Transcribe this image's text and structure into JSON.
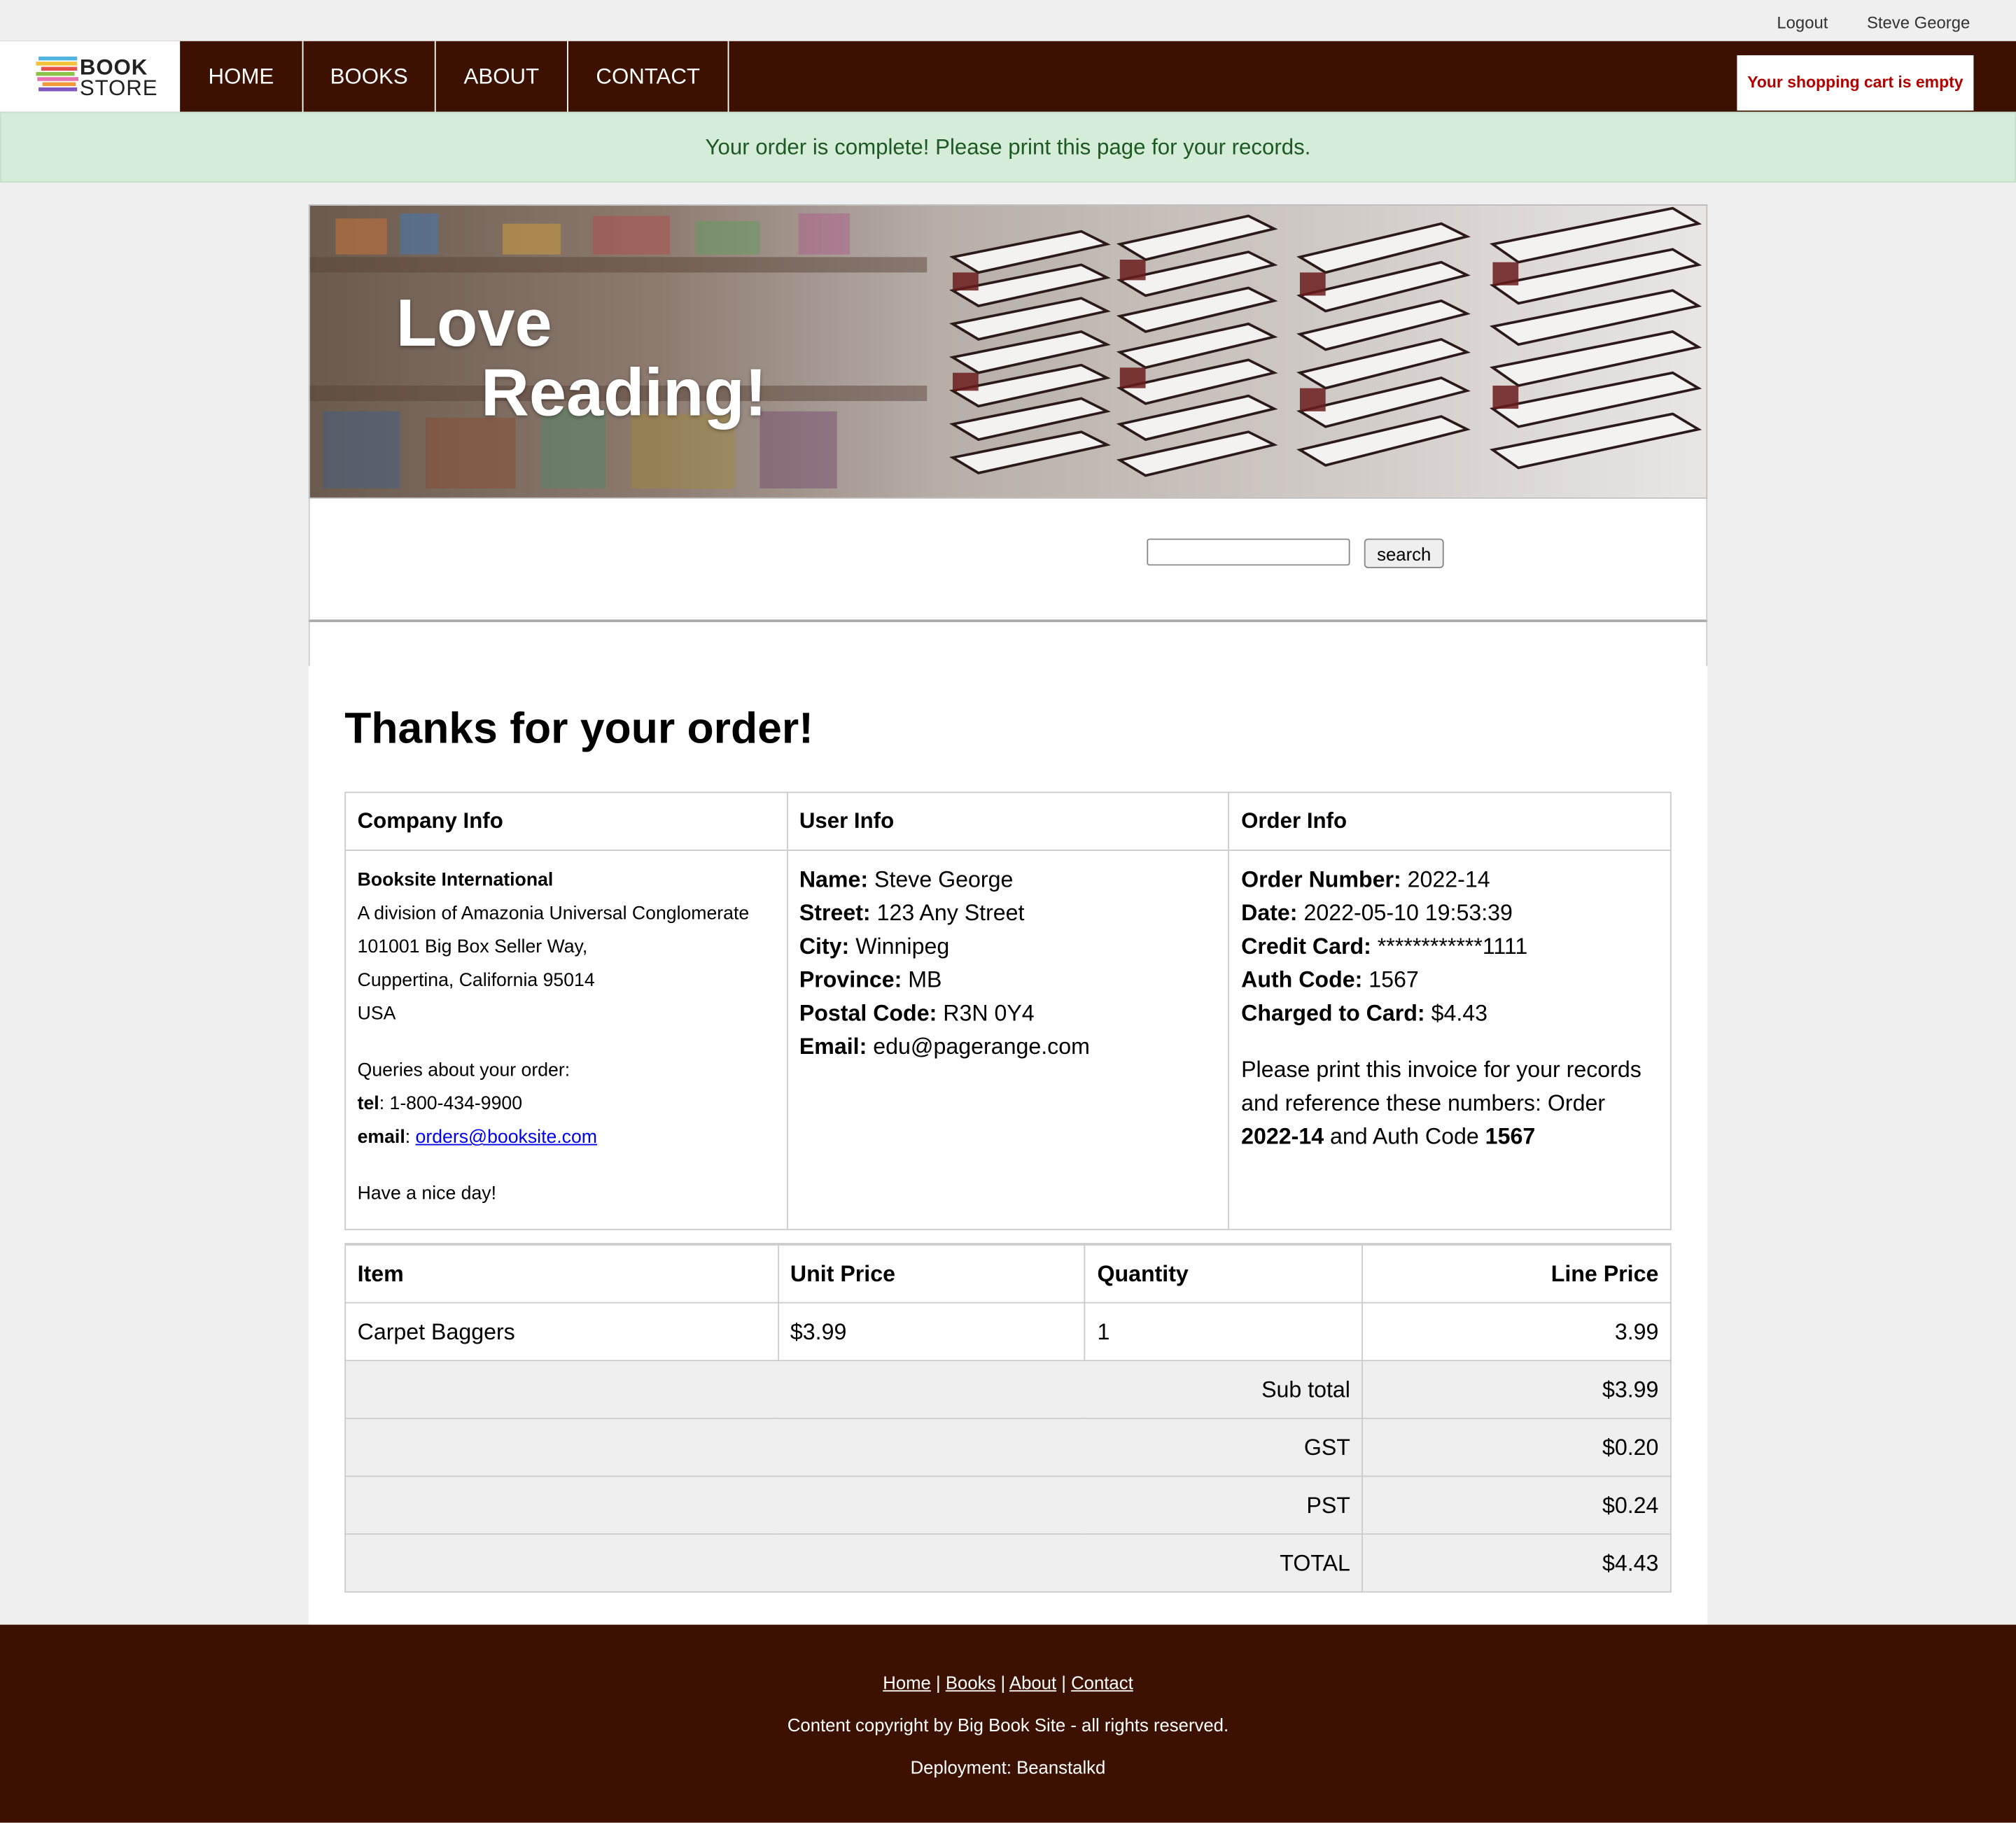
{
  "topbar": {
    "logout": "Logout",
    "user": "Steve George"
  },
  "logo": {
    "line1": "BOOK",
    "line2": "STORE"
  },
  "nav": {
    "items": [
      "HOME",
      "BOOKS",
      "ABOUT",
      "CONTACT"
    ]
  },
  "cart": {
    "status": "Your shopping cart is empty"
  },
  "alert": {
    "message": "Your order is complete! Please print this page for your records."
  },
  "banner": {
    "line1": "Love",
    "line2": "Reading!"
  },
  "search": {
    "value": "",
    "button": "search"
  },
  "page": {
    "title": "Thanks for your order!"
  },
  "info": {
    "headers": [
      "Company Info",
      "User Info",
      "Order Info"
    ],
    "company": {
      "name": "Booksite International",
      "lines": [
        "A division of Amazonia Universal Conglomerate",
        "101001 Big Box Seller Way,",
        "Cuppertina, California 95014",
        "USA"
      ],
      "queries": "Queries about your order:",
      "tel_label": "tel",
      "tel": "1-800-434-9900",
      "email_label": "email",
      "email": "orders@booksite.com",
      "closing": "Have a nice day!"
    },
    "user": {
      "name_label": "Name:",
      "name": "Steve George",
      "street_label": "Street:",
      "street": "123 Any Street",
      "city_label": "City:",
      "city": "Winnipeg",
      "province_label": "Province:",
      "province": "MB",
      "postal_label": "Postal Code:",
      "postal": "R3N 0Y4",
      "email_label": "Email:",
      "email": "edu@pagerange.com"
    },
    "order": {
      "number_label": "Order Number:",
      "number": "2022-14",
      "date_label": "Date:",
      "date": "2022-05-10 19:53:39",
      "card_label": "Credit Card:",
      "card": "************1111",
      "auth_label": "Auth Code:",
      "auth": "1567",
      "charged_label": "Charged to Card:",
      "charged": "$4.43",
      "note_a": "Please print this invoice for your records and reference these numbers: Order",
      "note_b": "and Auth Code"
    }
  },
  "items": {
    "headers": [
      "Item",
      "Unit Price",
      "Quantity",
      "Line Price"
    ],
    "rows": [
      {
        "item": "Carpet Baggers",
        "unit_price": "$3.99",
        "quantity": "1",
        "line_price": "3.99"
      }
    ],
    "summary": [
      {
        "label": "Sub total",
        "value": "$3.99"
      },
      {
        "label": "GST",
        "value": "$0.20"
      },
      {
        "label": "PST",
        "value": "$0.24"
      },
      {
        "label": "TOTAL",
        "value": "$4.43"
      }
    ]
  },
  "footer": {
    "links": [
      "Home",
      "Books",
      "About",
      "Contact"
    ],
    "separator": "|",
    "copyright": "Content copyright by Big Book Site - all rights reserved.",
    "deployment": "Deployment: Beanstalkd"
  },
  "colors": {
    "nav": "#3d1101",
    "alert_bg": "#d5ecd8",
    "alert_text": "#1d5a23",
    "cart_text": "#b00000"
  }
}
